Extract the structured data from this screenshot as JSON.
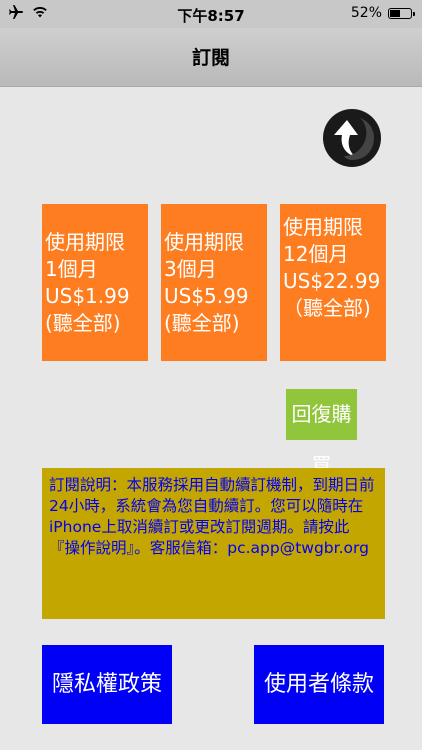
{
  "status_bar": {
    "time": "下午8:57",
    "battery_text": "52%",
    "battery_level": 0.52
  },
  "nav": {
    "title": "訂閱"
  },
  "plans": [
    {
      "lines": [
        "使用期限",
        "1個月",
        "US$1.99",
        "(聽全部)"
      ]
    },
    {
      "lines": [
        "使用期限",
        "3個月",
        "US$5.99",
        "(聽全部)"
      ]
    },
    {
      "lines": [
        "使用期限",
        "12個月",
        "US$22.99（聽全部)"
      ]
    }
  ],
  "restore_label": "回復購買",
  "notice_text": "訂閱說明：本服務採用自動續訂機制，到期日前24小時，系統會為您自動續訂。您可以隨時在iPhone上取消續訂或更改訂閱週期。請按此『操作說明』。客服信箱：pc.app@twgbr.org",
  "privacy_label": "隱私權政策",
  "terms_label": "使用者條款"
}
